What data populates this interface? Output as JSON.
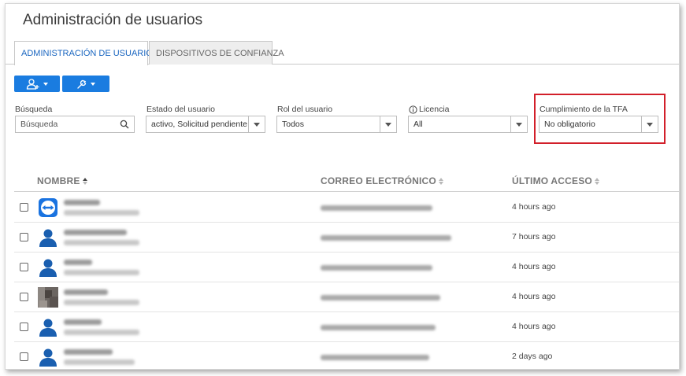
{
  "page": {
    "title": "Administración de usuarios"
  },
  "tabs": [
    {
      "label": "ADMINISTRACIÓN DE USUARIOS",
      "active": true
    },
    {
      "label": "DISPOSITIVOS DE CONFIANZA",
      "active": false
    }
  ],
  "toolbar": {
    "add_user_icon": "add-user-icon",
    "tools_icon": "wrench-icon",
    "accent": "#1a7ce0"
  },
  "filters": {
    "search": {
      "label": "Búsqueda",
      "placeholder": "Búsqueda"
    },
    "status": {
      "label": "Estado del usuario",
      "value": "activo, Solicitud pendiente"
    },
    "role": {
      "label": "Rol del usuario",
      "value": "Todos"
    },
    "license": {
      "label": "Licencia",
      "value": "All"
    },
    "tfa": {
      "label": "Cumplimiento de la TFA",
      "value": "No obligatorio",
      "highlight_color": "#d21f2a"
    }
  },
  "table": {
    "columns": {
      "name": "NOMBRE",
      "email": "CORREO ELECTRÓNICO",
      "last_access": "ÚLTIMO ACCESO"
    },
    "rows": [
      {
        "avatar": "teamviewer-logo",
        "last_access": "4 hours ago"
      },
      {
        "avatar": "user-silhouette",
        "last_access": "7 hours ago"
      },
      {
        "avatar": "user-silhouette",
        "last_access": "4 hours ago"
      },
      {
        "avatar": "photo",
        "last_access": "4 hours ago"
      },
      {
        "avatar": "user-silhouette",
        "last_access": "4 hours ago"
      },
      {
        "avatar": "user-silhouette",
        "last_access": "2 days ago"
      }
    ]
  }
}
